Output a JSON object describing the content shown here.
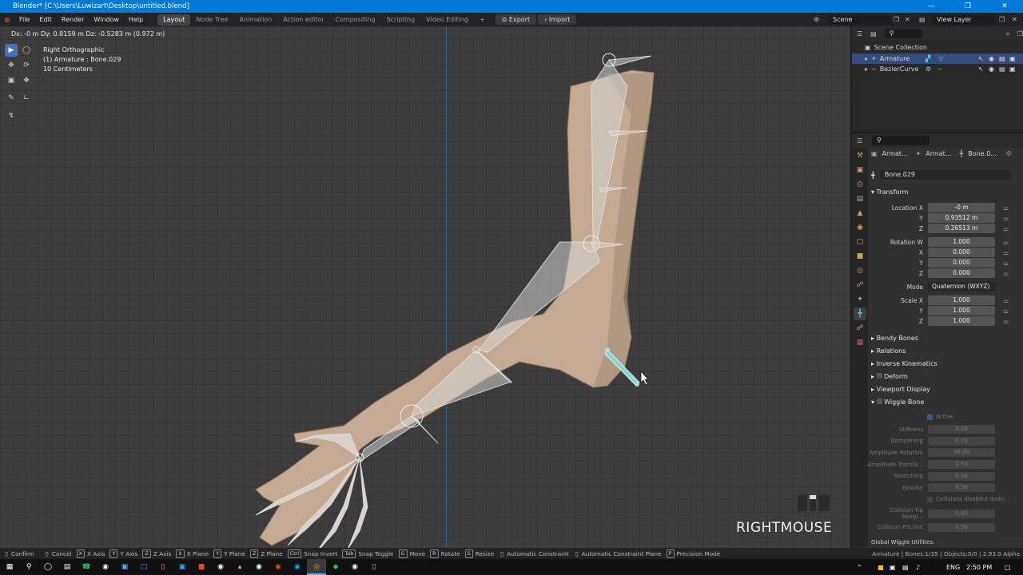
{
  "window": {
    "title": "Blender* [C:\\Users\\Luwizart\\Desktop\\untitled.blend]"
  },
  "menu": [
    "File",
    "Edit",
    "Render",
    "Window",
    "Help"
  ],
  "workspaces": [
    "Layout",
    "Node Tree",
    "Animation",
    "Action editor",
    "Compositing",
    "Scripting",
    "Video Editing"
  ],
  "actions": {
    "export": "Export",
    "import": "Import"
  },
  "scene": {
    "name": "Scene",
    "view_layer": "View Layer"
  },
  "viewport": {
    "readout": "Dx: -0 m   Dy: 0.8159 m  Dz: -0.5283 m (0.972 m)",
    "view_name": "Right Orthographic",
    "active": "(1) Armature : Bone.029",
    "scale": "10 Centimeters",
    "key_hint": "RIGHTMOUSE"
  },
  "outliner": {
    "collection": "Scene Collection",
    "items": [
      {
        "name": "Armature",
        "selected": true
      },
      {
        "name": "BezierCurve",
        "selected": false
      }
    ]
  },
  "properties": {
    "breadcrumb": [
      "Armat...",
      "Armat...",
      "Bone.0..."
    ],
    "bone_name": "Bone.029",
    "transform_label": "Transform",
    "location": {
      "label": "Location X",
      "x": "-0 m",
      "y": "0.93512 m",
      "z": "0.26513 m"
    },
    "rotation": {
      "label": "Rotation W",
      "w": "1.000",
      "x": "0.000",
      "y": "0.000",
      "z": "0.000"
    },
    "mode_label": "Mode",
    "mode": "Quaternion (WXYZ)",
    "scale": {
      "label": "Scale X",
      "x": "1.000",
      "y": "1.000",
      "z": "1.000"
    },
    "axis_y": "Y",
    "axis_z": "Z",
    "axis_x": "X",
    "sections": [
      "Bendy Bones",
      "Relations",
      "Inverse Kinematics",
      "Deform",
      "Viewport Display",
      "Wiggle Bone"
    ],
    "wiggle": {
      "active": "Active",
      "rows": [
        {
          "label": "Stiffness",
          "value": "0.20"
        },
        {
          "label": "Dampening",
          "value": "0.20"
        },
        {
          "label": "Amplitude Rotation",
          "value": "30.00"
        },
        {
          "label": "Amplitude Transla...",
          "value": "0.50"
        },
        {
          "label": "Stretching",
          "value": "0.50"
        },
        {
          "label": "Gravity",
          "value": "0.50"
        }
      ],
      "collisions": "Collisions disabled durin...",
      "rows2": [
        {
          "label": "Collision Tip Margi...",
          "value": "0.40"
        },
        {
          "label": "Collision Friction",
          "value": "0.50"
        }
      ],
      "global": "Global Wiggle Utilities:"
    }
  },
  "statusbar": {
    "items": [
      "Confirm",
      "Cancel",
      "X Axis",
      "Y Axis",
      "Z Axis",
      "X Plane",
      "Y Plane",
      "Z Plane",
      "Snap Invert",
      "Snap Toggle",
      "Move",
      "Rotate",
      "Resize",
      "Automatic Constraint",
      "Automatic Constraint Plane",
      "Precision Mode"
    ],
    "keys": [
      "X",
      "Y",
      "Z",
      "X",
      "Y",
      "Z",
      "Ctrl",
      "Tab",
      "G",
      "R",
      "S",
      "",
      "",
      "P"
    ],
    "info": "Armature | Bones:1/35 | Objects:0/0 | 2.93.0 Alpha"
  },
  "taskbar": {
    "lang": "ENG",
    "time": "2:50 PM"
  },
  "colors": {
    "accent": "#4772b3",
    "titlebar": "#0078d7",
    "bone_selected": "#8fd1d1"
  }
}
